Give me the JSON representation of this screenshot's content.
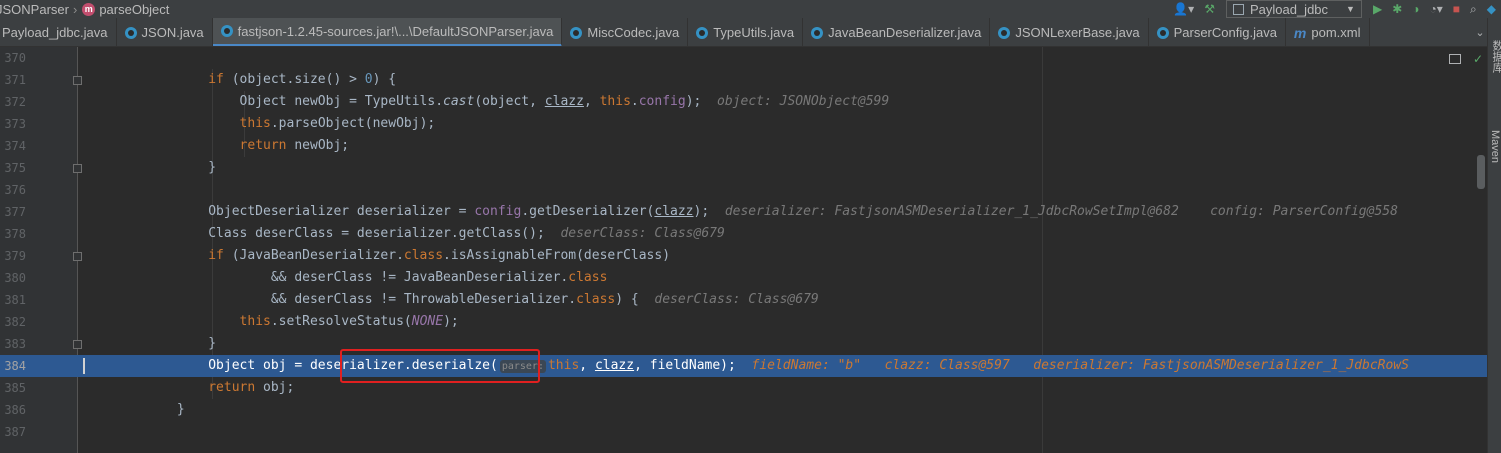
{
  "breadcrumb": {
    "class_name": "JSONParser",
    "method_badge": "m",
    "method_name": "parseObject"
  },
  "toolbar": {
    "run_config": "Payload_jdbc"
  },
  "tabs": [
    {
      "label": "Payload_jdbc.java",
      "active": false
    },
    {
      "label": "JSON.java",
      "active": false
    },
    {
      "label": "fastjson-1.2.45-sources.jar!\\...\\DefaultJSONParser.java",
      "active": true
    },
    {
      "label": "MiscCodec.java",
      "active": false
    },
    {
      "label": "TypeUtils.java",
      "active": false
    },
    {
      "label": "JavaBeanDeserializer.java",
      "active": false
    },
    {
      "label": "JSONLexerBase.java",
      "active": false
    },
    {
      "label": "ParserConfig.java",
      "active": false
    },
    {
      "label": "pom.xml",
      "active": false
    }
  ],
  "right_panel": {
    "database_label": "数据库",
    "maven_label": "Maven"
  },
  "editor": {
    "line_numbers": [
      "370",
      "371",
      "372",
      "373",
      "374",
      "375",
      "376",
      "377",
      "378",
      "379",
      "380",
      "381",
      "382",
      "383",
      "384",
      "385",
      "386",
      "387"
    ],
    "current_line": "384",
    "hints": {
      "l372": "object: JSONObject@599",
      "l377a": "deserializer: FastjsonASMDeserializer_1_JdbcRowSetImpl@682",
      "l377b": "config: ParserConfig@558",
      "l378": "deserClass: Class@679",
      "l381": "deserClass: Class@679",
      "l384a": "fieldName: \"b\"",
      "l384b": "clazz: Class@597",
      "l384c": "deserializer: FastjsonASMDeserializer_1_JdbcRowS",
      "l384_inlay": "parser:"
    }
  },
  "colors": {
    "background": "#2b2b2b",
    "keyword": "#cc7832",
    "field": "#9876aa",
    "current_line": "#2d5992",
    "highlight_box": "#e02020"
  }
}
